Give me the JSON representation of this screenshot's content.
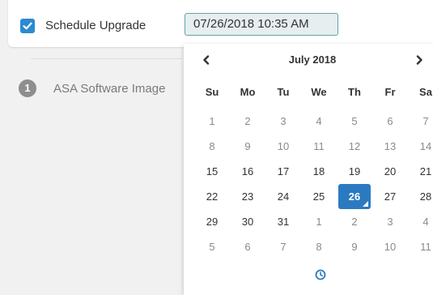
{
  "schedule": {
    "checked": true,
    "label": "Schedule Upgrade",
    "datetime_value": "07/26/2018 10:35 AM"
  },
  "step": {
    "number": "1",
    "label": "ASA Software Image"
  },
  "datepicker": {
    "month_title": "July 2018",
    "weekdays": [
      "Su",
      "Mo",
      "Tu",
      "We",
      "Th",
      "Fr",
      "Sa"
    ],
    "weeks": [
      [
        {
          "d": "1",
          "m": true
        },
        {
          "d": "2",
          "m": true
        },
        {
          "d": "3",
          "m": true
        },
        {
          "d": "4",
          "m": true
        },
        {
          "d": "5",
          "m": true
        },
        {
          "d": "6",
          "m": true
        },
        {
          "d": "7",
          "m": true
        }
      ],
      [
        {
          "d": "8",
          "m": true
        },
        {
          "d": "9",
          "m": true
        },
        {
          "d": "10",
          "m": true
        },
        {
          "d": "11",
          "m": true
        },
        {
          "d": "12",
          "m": true
        },
        {
          "d": "13",
          "m": true
        },
        {
          "d": "14",
          "m": true
        }
      ],
      [
        {
          "d": "15"
        },
        {
          "d": "16"
        },
        {
          "d": "17"
        },
        {
          "d": "18"
        },
        {
          "d": "19"
        },
        {
          "d": "20"
        },
        {
          "d": "21"
        }
      ],
      [
        {
          "d": "22"
        },
        {
          "d": "23"
        },
        {
          "d": "24"
        },
        {
          "d": "25"
        },
        {
          "d": "26",
          "selected": true
        },
        {
          "d": "27"
        },
        {
          "d": "28"
        }
      ],
      [
        {
          "d": "29"
        },
        {
          "d": "30"
        },
        {
          "d": "31"
        },
        {
          "d": "1",
          "m": true
        },
        {
          "d": "2",
          "m": true
        },
        {
          "d": "3",
          "m": true
        },
        {
          "d": "4",
          "m": true
        }
      ],
      [
        {
          "d": "5",
          "m": true
        },
        {
          "d": "6",
          "m": true
        },
        {
          "d": "7",
          "m": true
        },
        {
          "d": "8",
          "m": true
        },
        {
          "d": "9",
          "m": true
        },
        {
          "d": "10",
          "m": true
        },
        {
          "d": "11",
          "m": true
        }
      ]
    ],
    "icons": {
      "prev": "chevron-left-icon",
      "next": "chevron-right-icon",
      "time": "clock-icon"
    }
  },
  "colors": {
    "accent": "#2b7ac1",
    "checkbox": "#2b8ad1",
    "input_border": "#62a4a7",
    "input_bg": "#e7eeef"
  }
}
